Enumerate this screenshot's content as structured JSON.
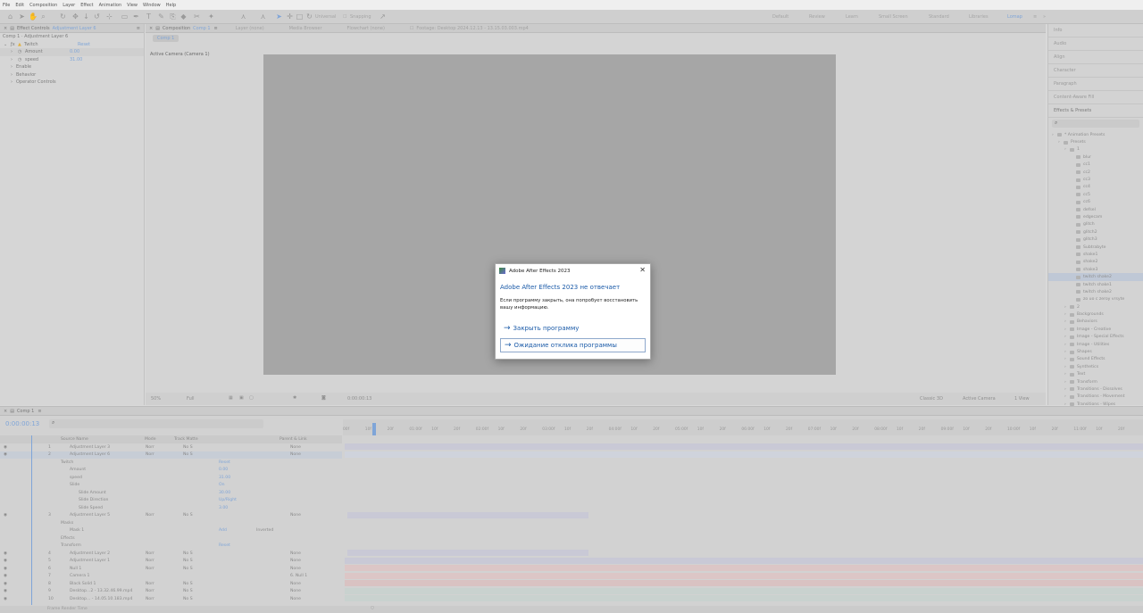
{
  "menu": [
    "File",
    "Edit",
    "Composition",
    "Layer",
    "Effect",
    "Animation",
    "View",
    "Window",
    "Help"
  ],
  "toolbar": {
    "universal": "Universal",
    "snapping": "Snapping",
    "workspaces": [
      "Default",
      "Review",
      "Learn",
      "Small Screen",
      "Standard",
      "Libraries",
      "Lomap"
    ]
  },
  "left_panel": {
    "tab": "Effect Controls",
    "tab_layer": "Adjustment Layer 6",
    "crumb": "Comp 1 · Adjustment Layer 6",
    "effect": {
      "name": "Twitch",
      "reset": "Reset",
      "rows": [
        {
          "label": "Amount",
          "value": "0.00"
        },
        {
          "label": "speed",
          "value": "31.00"
        }
      ],
      "groups": [
        "Enable",
        "Behavior",
        "Operator Controls"
      ]
    }
  },
  "viewer": {
    "tab": "Composition",
    "tab_comp": "Comp 1",
    "other_tabs": [
      "Layer (none)",
      "Media Browser",
      "Flowchart (none)",
      "Footage: Desktop 2024.12.13 - 13.15.03.003.mp4"
    ],
    "comp_chip": "Comp 1",
    "camera_label": "Active Camera (Camera 1)",
    "footer": {
      "zoom": "50%",
      "resolution": "Full",
      "time": "0:00:00:13",
      "renderer": "Classic 3D",
      "camera": "Active Camera",
      "views": "1 View"
    }
  },
  "right_panel": {
    "items": [
      "Info",
      "Audio",
      "Align",
      "Character",
      "Paragraph",
      "Content-Aware Fill"
    ],
    "effects_presets": "Effects & Presets",
    "tree": [
      {
        "d": 0,
        "t": "* Animation Presets"
      },
      {
        "d": 1,
        "t": "Presets"
      },
      {
        "d": 2,
        "t": "1"
      },
      {
        "d": 3,
        "t": "blur"
      },
      {
        "d": 3,
        "t": "cc1"
      },
      {
        "d": 3,
        "t": "cc2"
      },
      {
        "d": 3,
        "t": "cc3"
      },
      {
        "d": 3,
        "t": "cc4"
      },
      {
        "d": 3,
        "t": "cc5"
      },
      {
        "d": 3,
        "t": "cc6"
      },
      {
        "d": 3,
        "t": "defsel"
      },
      {
        "d": 3,
        "t": "edgecam"
      },
      {
        "d": 3,
        "t": "glitch"
      },
      {
        "d": 3,
        "t": "glitch2"
      },
      {
        "d": 3,
        "t": "glitch3"
      },
      {
        "d": 3,
        "t": "Subtrabyte"
      },
      {
        "d": 3,
        "t": "shake1"
      },
      {
        "d": 3,
        "t": "shake2"
      },
      {
        "d": 3,
        "t": "shake3"
      },
      {
        "d": 3,
        "t": "twitch shake2",
        "sel": true
      },
      {
        "d": 3,
        "t": "twitch shake1"
      },
      {
        "d": 3,
        "t": "twitch shake2"
      },
      {
        "d": 3,
        "t": "zo uo c zeroy vrsyte"
      },
      {
        "d": 2,
        "t": "2"
      },
      {
        "d": 2,
        "t": "Backgrounds"
      },
      {
        "d": 2,
        "t": "Behaviors"
      },
      {
        "d": 2,
        "t": "Image - Creative"
      },
      {
        "d": 2,
        "t": "Image - Special Effects"
      },
      {
        "d": 2,
        "t": "Image - Utilities"
      },
      {
        "d": 2,
        "t": "Shapes"
      },
      {
        "d": 2,
        "t": "Sound Effects"
      },
      {
        "d": 2,
        "t": "Synthetics"
      },
      {
        "d": 2,
        "t": "Text"
      },
      {
        "d": 2,
        "t": "Transform"
      },
      {
        "d": 2,
        "t": "Transitions - Dissolves"
      },
      {
        "d": 2,
        "t": "Transitions - Movement"
      },
      {
        "d": 2,
        "t": "Transitions - Wipes"
      }
    ]
  },
  "timeline": {
    "tab": "Comp 1",
    "timecode": "0:00:00:13",
    "headers": {
      "source": "Source Name",
      "mode": "Mode",
      "trkmat": "Track Matte",
      "parent": "Parent & Link"
    },
    "ruler": [
      "00f",
      "10f",
      "20f",
      "01:00f",
      "10f",
      "20f",
      "02:00f",
      "10f",
      "20f",
      "03:00f",
      "10f",
      "20f",
      "04:00f",
      "10f",
      "20f",
      "05:00f",
      "10f",
      "20f",
      "06:00f",
      "10f",
      "20f",
      "07:00f",
      "10f",
      "20f",
      "08:00f",
      "10f",
      "20f",
      "09:00f",
      "10f",
      "20f",
      "10:00f",
      "10f",
      "20f",
      "11:00f",
      "10f",
      "20f"
    ],
    "rows": [
      {
        "n": "1",
        "name": "Adjustment Layer 3",
        "mode": "Norr",
        "tm": "No S",
        "parent": "None"
      },
      {
        "n": "2",
        "name": "Adjustment Layer 6",
        "mode": "Norr",
        "tm": "No S",
        "parent": "None"
      },
      {
        "n": "",
        "name": "Twitch",
        "value": "Reset",
        "sub": 1
      },
      {
        "n": "",
        "name": "Amount",
        "value": "0.00",
        "sub": 2
      },
      {
        "n": "",
        "name": "speed",
        "value": "31.00",
        "sub": 2
      },
      {
        "n": "",
        "name": "Slide",
        "value": "On",
        "sub": 2
      },
      {
        "n": "",
        "name": "Slide Amount",
        "value": "30.00",
        "sub": 3
      },
      {
        "n": "",
        "name": "Slide Direction",
        "value": "Up/Right",
        "sub": 3
      },
      {
        "n": "",
        "name": "Slide Speed",
        "value": "3.00",
        "sub": 3
      },
      {
        "n": "3",
        "name": "Adjustment Layer 5",
        "mode": "Norr",
        "tm": "No S",
        "parent": "None"
      },
      {
        "n": "",
        "name": "Masks",
        "value": "",
        "sub": 1
      },
      {
        "n": "",
        "name": "Mask 1",
        "value": "Add",
        "extra": "Inverted",
        "sub": 2
      },
      {
        "n": "",
        "name": "Effects",
        "value": "",
        "sub": 1
      },
      {
        "n": "",
        "name": "Transform",
        "value": "Reset",
        "sub": 1
      },
      {
        "n": "4",
        "name": "Adjustment Layer 2",
        "mode": "Norr",
        "tm": "No S",
        "parent": "None"
      },
      {
        "n": "5",
        "name": "Adjustment Layer 1",
        "mode": "Norr",
        "tm": "No S",
        "parent": "None"
      },
      {
        "n": "6",
        "name": "Null 1",
        "mode": "Norr",
        "tm": "No S",
        "parent": "None"
      },
      {
        "n": "7",
        "name": "Camera 1",
        "mode": "",
        "tm": "",
        "parent": "6. Null 1"
      },
      {
        "n": "8",
        "name": "Black Solid 1",
        "mode": "Norr",
        "tm": "No S",
        "parent": "None"
      },
      {
        "n": "9",
        "name": "Desktop...2 - 13.32.46.99.mp4",
        "mode": "Norr",
        "tm": "No S",
        "parent": "None"
      },
      {
        "n": "10",
        "name": "Desktop... - 14.05.10.183.mp4",
        "mode": "Norr",
        "tm": "No S",
        "parent": "None"
      }
    ],
    "footer": "Frame Render Time"
  },
  "dialog": {
    "title": "Adobe After Effects 2023",
    "heading": "Adobe After Effects 2023 не отвечает",
    "body": "Если программу закрыть, она попробует восстановить вашу информацию.",
    "close_btn": "Закрыть программу",
    "wait_btn": "Ожидание отклика программы",
    "close_glyph": "✕"
  }
}
